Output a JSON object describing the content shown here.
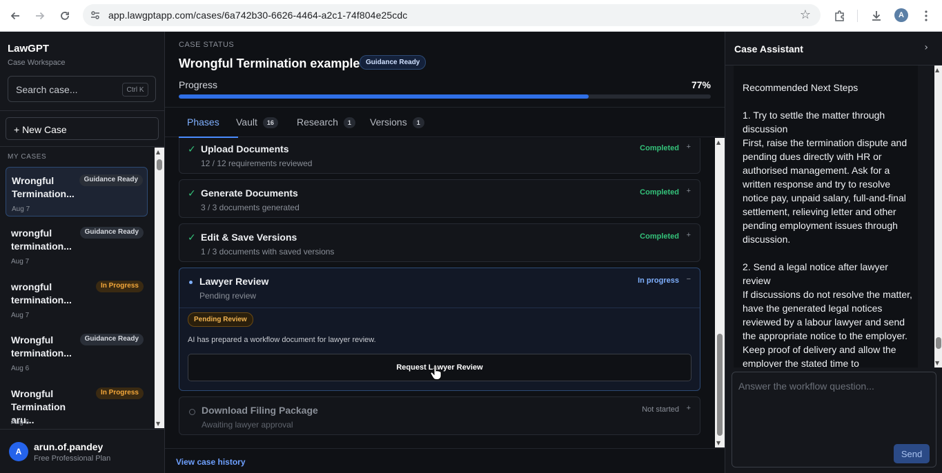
{
  "browser": {
    "url": "app.lawgptapp.com/cases/6a742b30-6626-4464-a2c1-74f804e25cdc",
    "profile_initial": "A"
  },
  "sidebar": {
    "brand": "LawGPT",
    "brand_sub": "Case Workspace",
    "search_placeholder": "Search case...",
    "search_shortcut": "Ctrl K",
    "new_case_label": "+ New Case",
    "section_label": "MY CASES",
    "cases": [
      {
        "title": "Wrongful Termination...",
        "date": "Aug 7",
        "badge": "Guidance Ready",
        "badge_type": "ready",
        "active": true
      },
      {
        "title": "wrongful termination...",
        "date": "Aug 7",
        "badge": "Guidance Ready",
        "badge_type": "ready",
        "active": false
      },
      {
        "title": "wrongful termination...",
        "date": "Aug 7",
        "badge": "In Progress",
        "badge_type": "progress",
        "active": false
      },
      {
        "title": "Wrongful termination...",
        "date": "Aug 6",
        "badge": "Guidance Ready",
        "badge_type": "ready",
        "active": false
      },
      {
        "title": "Wrongful Termination aru...",
        "date": "Aug 6",
        "badge": "In Progress",
        "badge_type": "progress",
        "active": false
      }
    ],
    "user": {
      "initial": "A",
      "name": "arun.of.pandey",
      "plan": "Free Professional Plan"
    }
  },
  "main": {
    "status_label": "CASE STATUS",
    "title": "Wrongful Termination example",
    "status_badge": "Guidance Ready",
    "progress_label": "Progress",
    "progress_pct_text": "77%",
    "progress_fraction": 0.77,
    "tabs": [
      {
        "label": "Phases",
        "count": ""
      },
      {
        "label": "Vault",
        "count": "16"
      },
      {
        "label": "Research",
        "count": "1"
      },
      {
        "label": "Versions",
        "count": "1"
      }
    ],
    "phases": [
      {
        "title": "Upload Documents",
        "sub": "12 / 12 requirements reviewed",
        "status": "Completed",
        "toggle": "+"
      },
      {
        "title": "Generate Documents",
        "sub": "3 / 3 documents generated",
        "status": "Completed",
        "toggle": "+"
      },
      {
        "title": "Edit & Save Versions",
        "sub": "1 / 3 documents with saved versions",
        "status": "Completed",
        "toggle": "+"
      },
      {
        "title": "Lawyer Review",
        "sub": "Pending review",
        "status": "In progress",
        "toggle": "−",
        "pending_badge": "Pending Review",
        "note": "AI has prepared a workflow document for lawyer review.",
        "button": "Request Lawyer Review"
      },
      {
        "title": "Download Filing Package",
        "sub": "Awaiting lawyer approval",
        "status": "Not started",
        "toggle": "+"
      }
    ],
    "history_link": "View case history",
    "colors": {
      "completed": "#34c27a",
      "in_progress": "#7fb0ff",
      "not_started": "#8a8f98"
    }
  },
  "assistant": {
    "title": "Case Assistant",
    "message": "Recommended Next Steps\n\n1. Try to settle the matter through discussion\nFirst, raise the termination dispute and pending dues directly with HR or authorised management. Ask for a written response and try to resolve notice pay, unpaid salary, full-and-final settlement, relieving letter and other pending employment issues through discussion.\n\n2. Send a legal notice after lawyer review\nIf discussions do not resolve the matter, have the generated legal notices reviewed by a labour lawyer and send the appropriate notice to the employer. Keep proof of delivery and allow the employer the stated time to",
    "input_placeholder": "Answer the workflow question...",
    "send_label": "Send"
  }
}
